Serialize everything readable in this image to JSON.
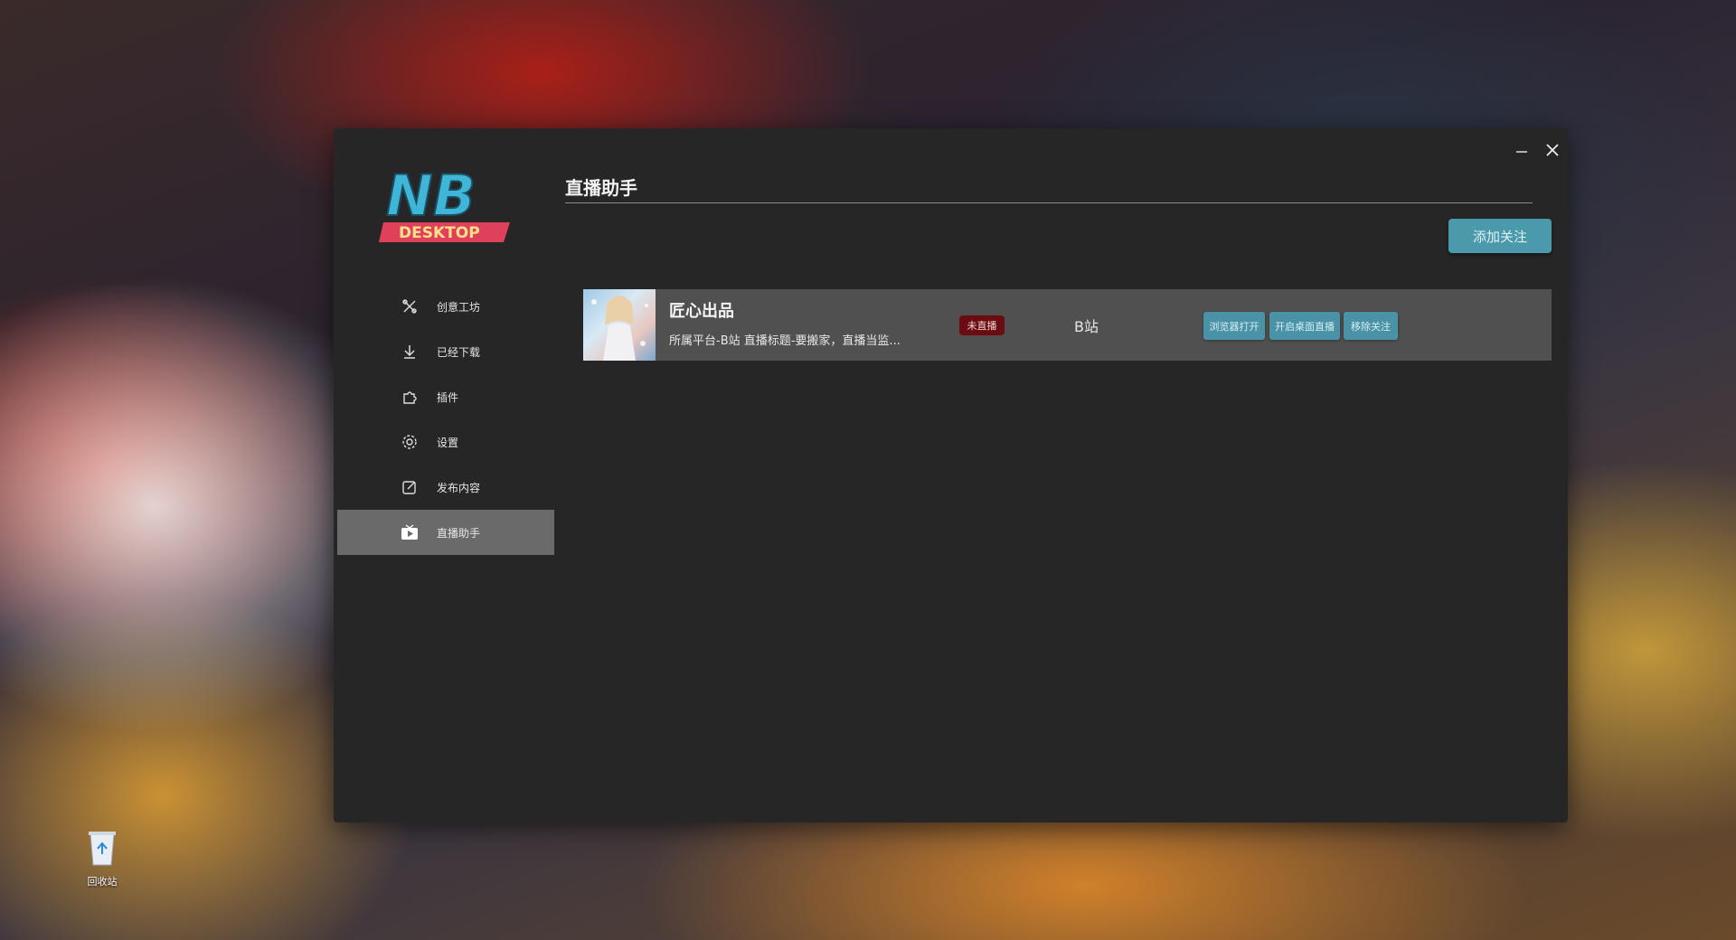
{
  "window": {
    "minimize_icon": "minimize-icon",
    "close_icon": "close-icon"
  },
  "logo": {
    "line1": "NB",
    "line2": "DESKTOP"
  },
  "sidebar": {
    "items": [
      {
        "label": "创意工坊",
        "icon": "workshop-tools-icon"
      },
      {
        "label": "已经下载",
        "icon": "download-icon"
      },
      {
        "label": "插件",
        "icon": "puzzle-icon"
      },
      {
        "label": "设置",
        "icon": "gear-icon"
      },
      {
        "label": "发布内容",
        "icon": "edit-icon"
      },
      {
        "label": "直播助手",
        "icon": "tv-icon",
        "active": true
      }
    ]
  },
  "main": {
    "title": "直播助手",
    "add_button": "添加关注",
    "streams": [
      {
        "name": "匠心出品",
        "description": "所属平台-B站 直播标题-要搬家，直播当监...",
        "status": "未直播",
        "platform": "B站",
        "buttons": {
          "open_browser": "浏览器打开",
          "open_desktop": "开启桌面直播",
          "remove": "移除关注"
        }
      }
    ]
  },
  "desktop": {
    "recycle_bin_label": "回收站"
  },
  "colors": {
    "window_bg": "#262626",
    "accent": "#4a9aab",
    "status_offline": "#6b0c10",
    "active_nav": "#6a6a6a"
  }
}
